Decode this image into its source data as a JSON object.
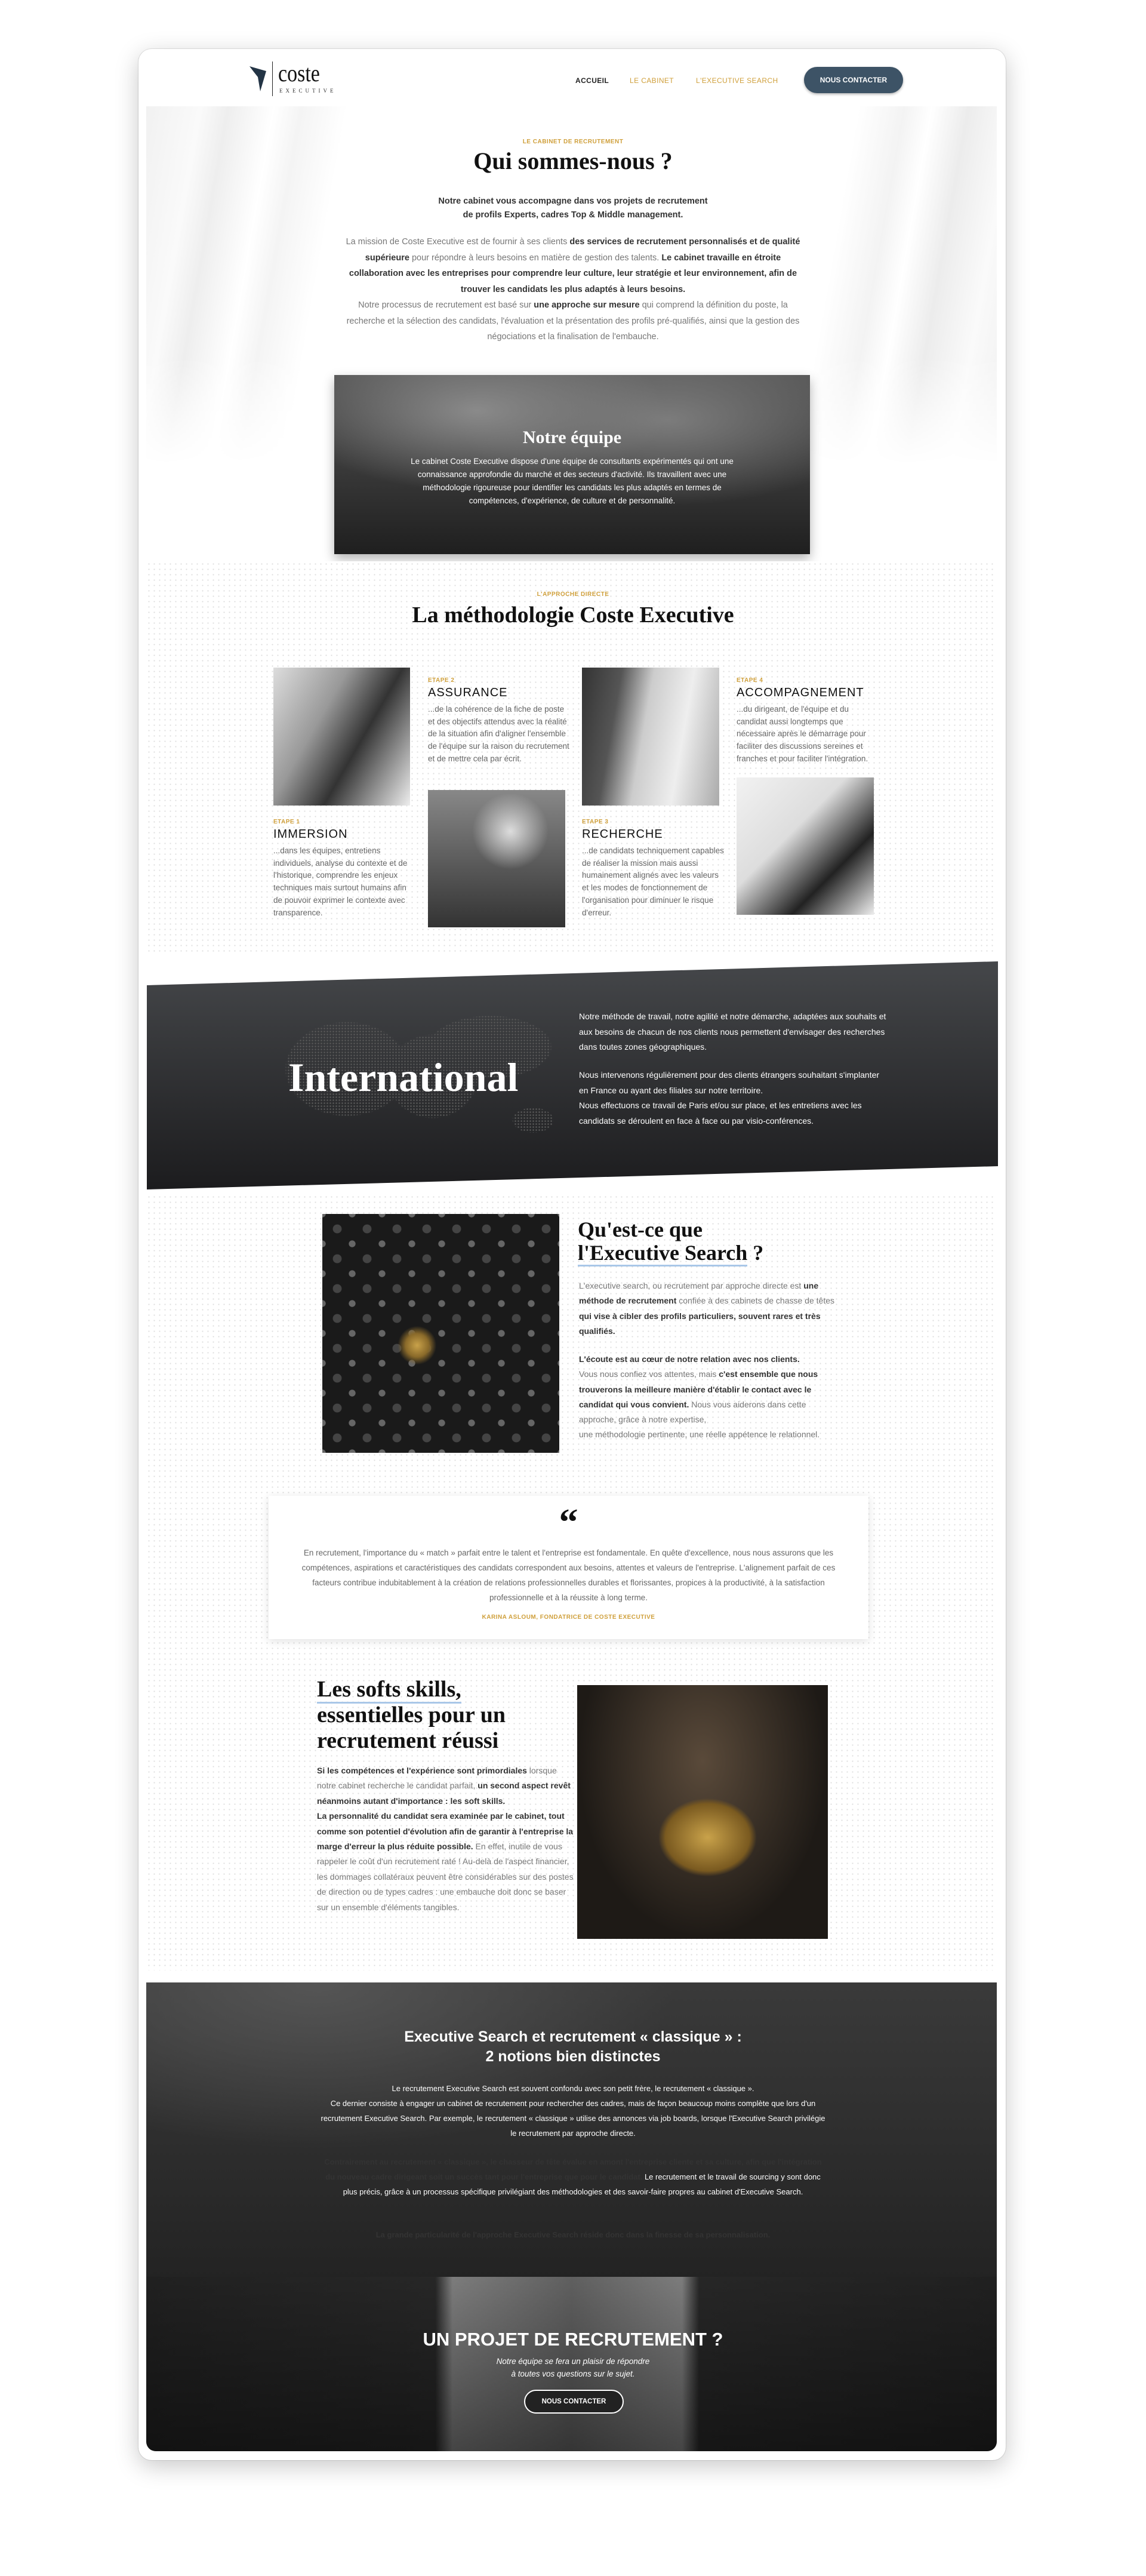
{
  "header": {
    "logo": {
      "word": "coste",
      "sub": "EXECUTIVE"
    },
    "nav": [
      {
        "label": "ACCUEIL",
        "active": true
      },
      {
        "label": "LE CABINET"
      },
      {
        "label": "L'EXECUTIVE SEARCH"
      }
    ],
    "cta": "NOUS CONTACTER"
  },
  "colors": {
    "gold": "#cf9f3a",
    "navy": "#3d5366",
    "underline": "#a9c7e8",
    "dark": "#2a2b2d"
  },
  "about": {
    "eyebrow": "LE CABINET DE RECRUTEMENT",
    "title": "Qui sommes-nous ?",
    "intro": "Notre cabinet vous accompagne dans vos projets de recrutement\nde profils Experts, cadres Top & Middle management.",
    "body": [
      {
        "t": "La mission de Coste Executive est de fournir à ses clients "
      },
      {
        "t": "des services de recrutement personnalisés et de qualité supérieure",
        "b": true
      },
      {
        "t": " pour répondre à leurs besoins en matière de gestion des talents. "
      },
      {
        "t": "Le cabinet travaille en étroite collaboration avec les entreprises pour comprendre leur culture, leur stratégie et leur environnement, afin de trouver les candidats les plus adaptés à leurs besoins.",
        "b": true
      },
      {
        "t": "\nNotre processus de recrutement est basé sur "
      },
      {
        "t": "une approche sur mesure",
        "b": true
      },
      {
        "t": " qui comprend la définition du poste, la recherche et la sélection des candidats, l'évaluation et la présentation des profils pré-qualifiés, ainsi que la gestion des négociations et la finalisation de l'embauche."
      }
    ]
  },
  "team": {
    "title": "Notre équipe",
    "body": "Le cabinet Coste Executive dispose d'une équipe de consultants expérimentés qui ont une connaissance approfondie du marché et des secteurs d'activité. Ils travaillent avec une méthodologie rigoureuse pour identifier les candidats les plus adaptés en termes de compétences, d'expérience, de culture et de personnalité."
  },
  "method": {
    "eyebrow": "L'APPROCHE DIRECTE",
    "title": "La méthodologie Coste Executive",
    "steps": [
      {
        "label": "ETAPE 1",
        "title": "IMMERSION",
        "body": "...dans les équipes, entretiens individuels, analyse du contexte et de l'historique, comprendre les enjeux techniques mais surtout humains afin de pouvoir exprimer le contexte avec transparence."
      },
      {
        "label": "ETAPE 2",
        "title": "ASSURANCE",
        "body": "...de la cohérence de la fiche de poste et des objectifs attendus avec la réalité de la situation afin d'aligner l'ensemble de l'équipe sur la raison du recrutement et de mettre cela par écrit."
      },
      {
        "label": "ETAPE 3",
        "title": "RECHERCHE",
        "body": "...de candidats techniquement capables de réaliser la mission mais aussi humainement alignés avec les valeurs et les modes de fonctionnement de l'organisation pour diminuer le risque d'erreur."
      },
      {
        "label": "ETAPE 4",
        "title": "ACCOMPAGNEMENT",
        "body": "...du dirigeant, de l'équipe et du candidat aussi longtemps que nécessaire après le démarrage pour faciliter des discussions sereines et franches et pour faciliter l'intégration."
      }
    ]
  },
  "international": {
    "title": "International",
    "p1": "Notre méthode de travail, notre agilité et notre démarche, adaptées aux souhaits et aux besoins de chacun de nos clients nous permettent d'envisager des recherches dans toutes zones géographiques.",
    "p2": "Nous intervenons régulièrement pour des clients étrangers souhaitant s'implanter en France ou ayant des filiales sur notre territoire.\nNous effectuons ce travail de Paris et/ou sur place, et les entretiens avec les candidats se déroulent en face à face ou par visio-conférences."
  },
  "exec": {
    "title_line1": "Qu'est-ce que",
    "title_underlined": "l'Executive Search",
    "title_end": " ?",
    "p1": [
      {
        "t": "L'executive search, ou recrutement par approche directe est "
      },
      {
        "t": "une méthode de recrutement",
        "b": true
      },
      {
        "t": " confiée à des cabinets de chasse de têtes "
      },
      {
        "t": "qui vise à cibler des profils particuliers, souvent rares et très qualifiés.",
        "b": true
      }
    ],
    "p2": [
      {
        "t": "L'écoute est au cœur de notre relation avec nos clients.",
        "b": true
      },
      {
        "t": "\nVous nous confiez vos attentes, mais "
      },
      {
        "t": "c'est ensemble que nous trouverons la meilleure manière d'établir le contact avec le candidat qui vous convient.",
        "b": true
      },
      {
        "t": " Nous vous aiderons dans cette approche, grâce à notre expertise,\nune méthodologie pertinente, une réelle appétence le relationnel."
      }
    ]
  },
  "quote": {
    "text": "En recrutement, l'importance du « match » parfait entre le talent et l'entreprise est fondamentale. En quête d'excellence, nous nous assurons que les compétences, aspirations et caractéristiques des candidats correspondent aux besoins, attentes et valeurs de l'entreprise. L'alignement parfait de ces facteurs contribue indubitablement à la création de relations professionnelles durables et florissantes, propices à la productivité, à la satisfaction professionnelle et à la réussite à long terme.",
    "author": "KARINA ASLOUM, FONDATRICE DE COSTE EXECUTIVE"
  },
  "soft": {
    "title_underlined": "Les softs skills,",
    "title_rest": "essentielles pour un recrutement réussi",
    "body": [
      {
        "t": "Si les compétences et l'expérience sont primordiales",
        "b": true
      },
      {
        "t": " lorsque notre cabinet recherche le candidat parfait, "
      },
      {
        "t": "un second aspect revêt néanmoins autant d'importance : les soft skills.",
        "b": true
      },
      {
        "t": "\n"
      },
      {
        "t": "La personnalité du candidat sera examinée par le cabinet, tout comme son potentiel d'évolution afin de garantir à l'entreprise la marge d'erreur la plus réduite possible.",
        "b": true
      },
      {
        "t": " En effet, inutile de vous rappeler le coût d'un recrutement raté ! Au-delà de l'aspect financier, les dommages collatéraux peuvent être considérables sur des postes de direction ou de types cadres : une embauche doit donc se baser sur un ensemble d'éléments tangibles."
      }
    ]
  },
  "compare": {
    "title": "Executive Search et recrutement « classique » :\n2 notions bien distinctes",
    "p1": [
      {
        "t": "Le recrutement Executive Search est souvent confondu avec son petit frère, le recrutement « classique ».\nCe dernier consiste à engager un cabinet de recrutement pour rechercher des cadres, mais de façon beaucoup moins complète que lors d'un recrutement Executive Search. Par exemple, le recrutement « classique » utilise des annonces via job boards, lorsque l'Executive Search privilégie le recrutement par approche directe."
      }
    ],
    "p2": [
      {
        "t": "Contrairement au recrutement « classique », le chasseur de tête évalue en amont l'entreprise cliente et sa culture, afin que l'intégration du nouveau cadre dirigeant soit un succès tant pour l'entreprise que pour le candidat.",
        "b": true
      },
      {
        "t": " Le recrutement et le travail de sourcing y sont donc plus précis, grâce à un processus spécifique privilégiant des méthodologies et des savoir-faire propres au cabinet d'Executive Search."
      }
    ],
    "p3": [
      {
        "t": "La grande particularité de l'approche Executive Search réside donc dans la finesse de sa personnalisation.",
        "b": true
      }
    ]
  },
  "cta": {
    "title": "UN PROJET DE RECRUTEMENT ?",
    "subtitle": "Notre équipe se fera un plaisir de répondre\nà toutes vos questions sur le sujet.",
    "button": "NOUS CONTACTER"
  }
}
